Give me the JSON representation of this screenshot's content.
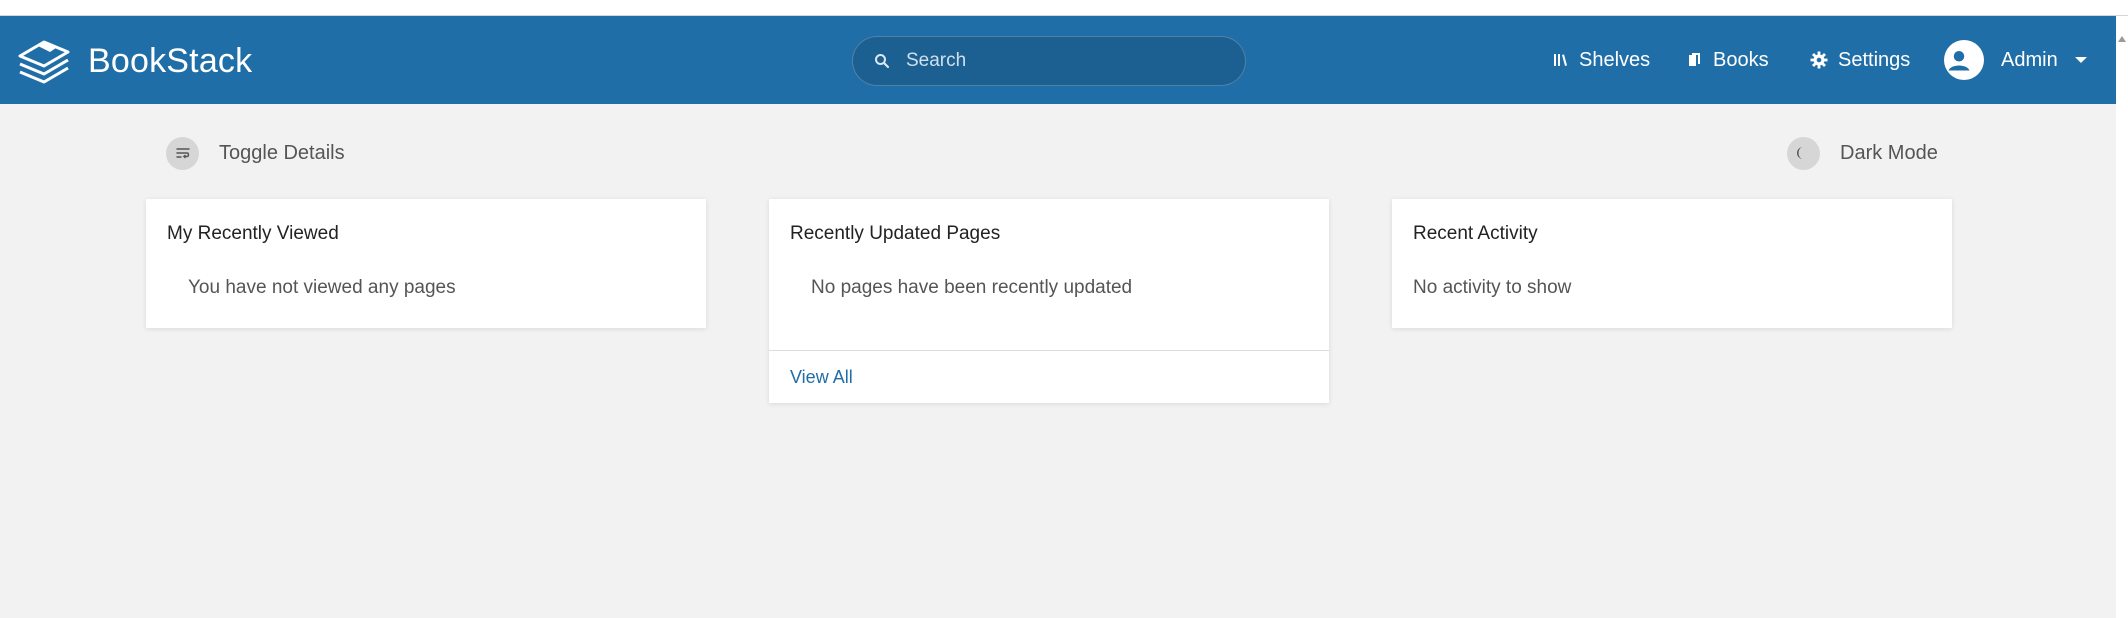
{
  "app": {
    "name": "BookStack"
  },
  "search": {
    "placeholder": "Search"
  },
  "nav": {
    "shelves": "Shelves",
    "books": "Books",
    "settings": "Settings",
    "user": "Admin"
  },
  "toolbar": {
    "toggle_details": "Toggle Details",
    "dark_mode": "Dark Mode"
  },
  "cards": [
    {
      "title": "My Recently Viewed",
      "empty_text": "You have not viewed any pages"
    },
    {
      "title": "Recently Updated Pages",
      "empty_text": "No pages have been recently updated",
      "link": "View All"
    },
    {
      "title": "Recent Activity",
      "empty_text": "No activity to show"
    }
  ],
  "colors": {
    "header": "#206ea7",
    "background": "#f2f2f2",
    "link": "#206ea7"
  },
  "icons": {
    "logo": "bookstack-logo-icon",
    "search": "search-icon",
    "shelves": "shelves-icon",
    "books": "books-icon",
    "settings": "gear-icon",
    "user": "user-avatar-icon",
    "toggle_details": "toggle-details-icon",
    "dark_mode": "moon-icon"
  }
}
